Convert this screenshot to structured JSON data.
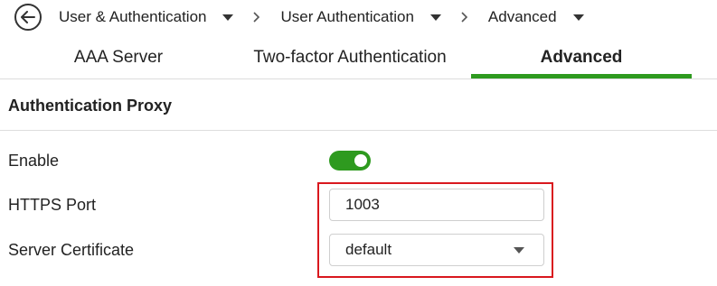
{
  "breadcrumb": {
    "items": [
      {
        "label": "User & Authentication"
      },
      {
        "label": "User Authentication"
      },
      {
        "label": "Advanced"
      }
    ]
  },
  "tabs": [
    {
      "label": "AAA Server",
      "active": false
    },
    {
      "label": "Two-factor Authentication",
      "active": false
    },
    {
      "label": "Advanced",
      "active": true
    }
  ],
  "section": {
    "title": "Authentication Proxy",
    "enable": {
      "label": "Enable",
      "on": true
    },
    "https_port": {
      "label": "HTTPS Port",
      "value": "1003"
    },
    "server_certificate": {
      "label": "Server Certificate",
      "value": "default"
    }
  },
  "colors": {
    "accent": "#2e9a1f",
    "highlight": "#d9181e"
  },
  "icons": {
    "back": "back-arrow-icon",
    "dropdown": "caret-down-icon",
    "separator": "chevron-right-icon"
  }
}
